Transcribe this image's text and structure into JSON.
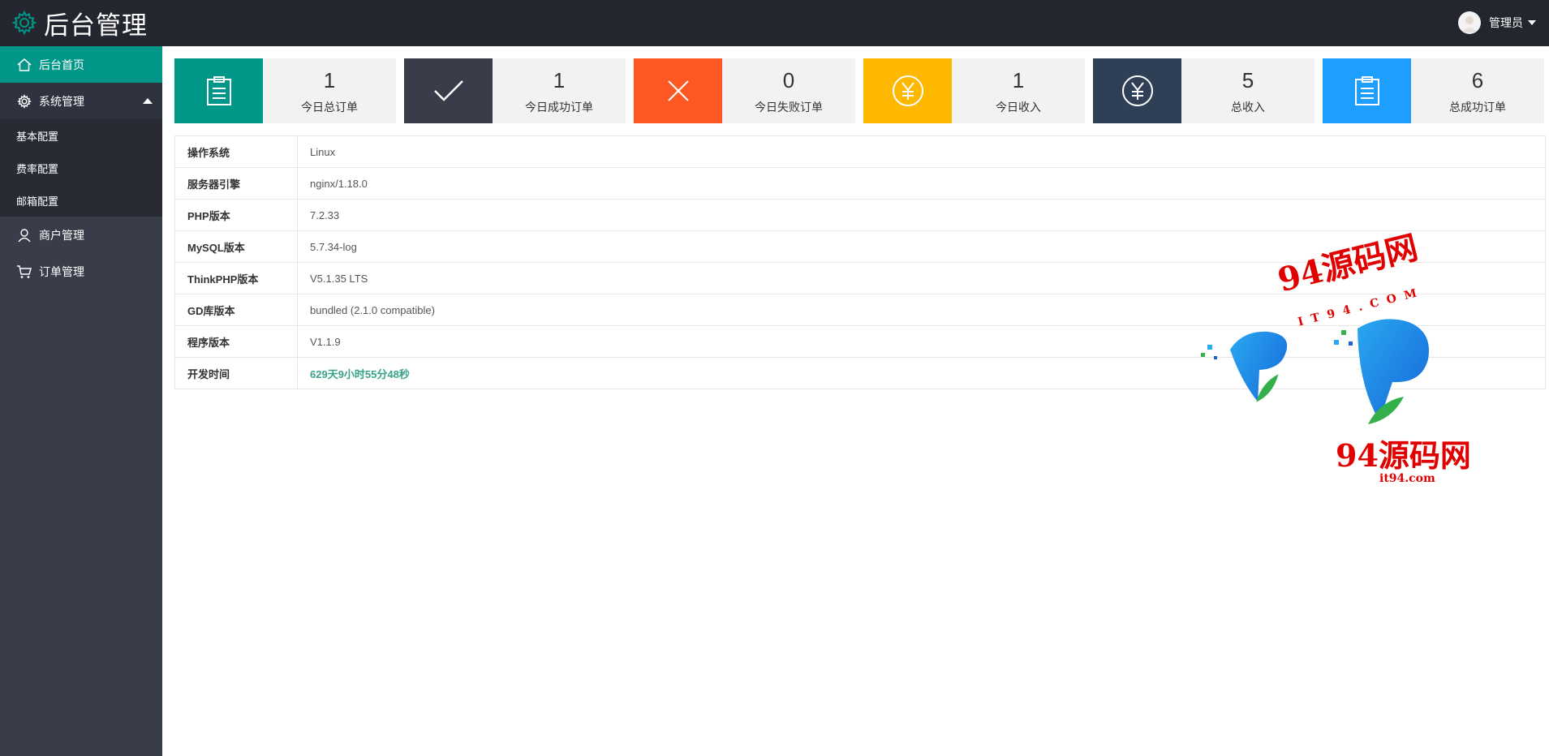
{
  "header": {
    "title": "后台管理",
    "user_name": "管理员"
  },
  "sidebar": {
    "items": [
      {
        "label": "后台首页"
      },
      {
        "label": "系统管理",
        "children": [
          {
            "label": "基本配置"
          },
          {
            "label": "费率配置"
          },
          {
            "label": "邮箱配置"
          }
        ]
      },
      {
        "label": "商户管理"
      },
      {
        "label": "订单管理"
      }
    ]
  },
  "stats": [
    {
      "value": "1",
      "label": "今日总订单",
      "color": "#009688",
      "icon": "clipboard-icon"
    },
    {
      "value": "1",
      "label": "今日成功订单",
      "color": "#393d49",
      "icon": "check-icon"
    },
    {
      "value": "0",
      "label": "今日失败订单",
      "color": "#ff5722",
      "icon": "close-icon"
    },
    {
      "value": "1",
      "label": "今日收入",
      "color": "#ffb800",
      "icon": "yen-icon"
    },
    {
      "value": "5",
      "label": "总收入",
      "color": "#2f4056",
      "icon": "yen-icon"
    },
    {
      "value": "6",
      "label": "总成功订单",
      "color": "#1e9fff",
      "icon": "clipboard-icon"
    }
  ],
  "info": [
    {
      "key": "操作系统",
      "value": "Linux"
    },
    {
      "key": "服务器引擎",
      "value": "nginx/1.18.0"
    },
    {
      "key": "PHP版本",
      "value": "7.2.33"
    },
    {
      "key": "MySQL版本",
      "value": "5.7.34-log"
    },
    {
      "key": "ThinkPHP版本",
      "value": "V5.1.35 LTS"
    },
    {
      "key": "GD库版本",
      "value": "bundled (2.1.0 compatible)"
    },
    {
      "key": "程序版本",
      "value": "V1.1.9"
    },
    {
      "key": "开发时间",
      "value": "629天9小时55分48秒"
    }
  ],
  "watermark": {
    "title": "94源码网",
    "sub": "IT94.COM",
    "domain": "it94.com"
  }
}
